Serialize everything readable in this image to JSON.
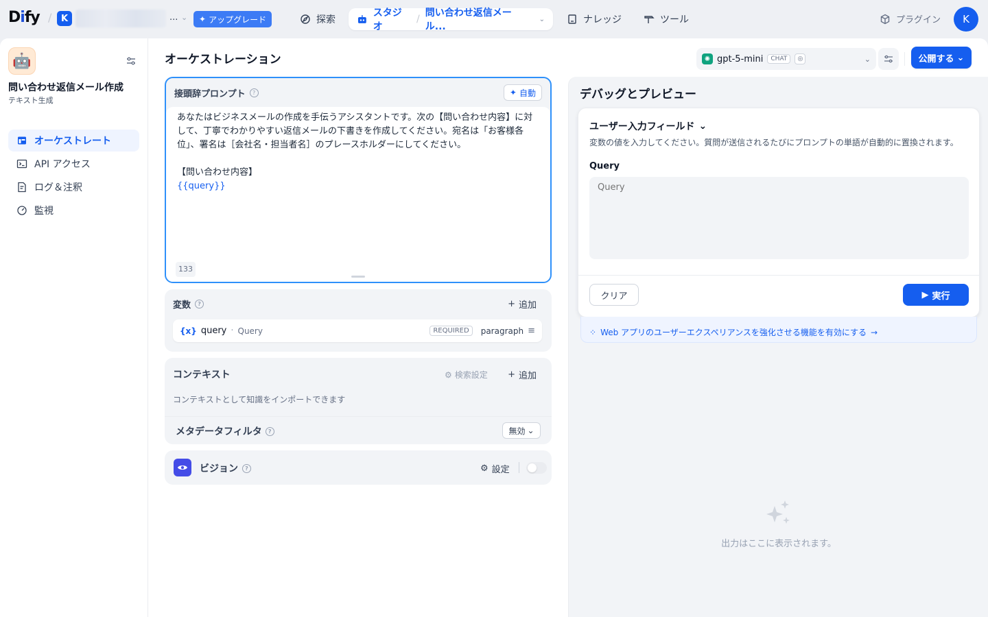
{
  "topbar": {
    "logo_prefix": "D",
    "logo_i": "i",
    "logo_suffix": "fy",
    "workspace_initial": "K",
    "workspace_ellipsis": "...",
    "upgrade_label": "アップグレード",
    "nav": {
      "explore": "探索",
      "studio": "スタジオ",
      "current_app": "問い合わせ返信メール...",
      "knowledge": "ナレッジ",
      "tools": "ツール"
    },
    "plugins_label": "プラグイン",
    "user_initial": "K"
  },
  "sidebar": {
    "app_icon": "🤖",
    "app_name": "問い合わせ返信メール作成",
    "app_type": "テキスト生成",
    "items": [
      {
        "label": "オーケストレート",
        "icon": "layout-icon",
        "active": true
      },
      {
        "label": "API アクセス",
        "icon": "terminal-icon",
        "active": false
      },
      {
        "label": "ログ＆注釈",
        "icon": "file-list-icon",
        "active": false
      },
      {
        "label": "監視",
        "icon": "dashboard-icon",
        "active": false
      }
    ]
  },
  "orchestration": {
    "title": "オーケストレーション",
    "model": {
      "name": "gpt-5-mini",
      "badge": "CHAT"
    },
    "publish_label": "公開する"
  },
  "prompt": {
    "title": "接頭辞プロンプト",
    "auto_label": "自動",
    "text": "あなたはビジネスメールの作成を手伝うアシスタントです。次の【問い合わせ内容】に対して、丁寧でわかりやすい返信メールの下書きを作成してください。宛名は「お客様各位」、署名は［会社名・担当者名］のプレースホルダーにしてください。\n\n【問い合わせ内容】",
    "variable_token": "{{query}}",
    "char_count": "133"
  },
  "variables": {
    "title": "変数",
    "add_label": "追加",
    "items": [
      {
        "icon": "{x}",
        "key": "query",
        "separator": "·",
        "label": "Query",
        "required": "REQUIRED",
        "type": "paragraph"
      }
    ]
  },
  "context": {
    "title": "コンテキスト",
    "retrieval_label": "検索設定",
    "add_label": "追加",
    "hint": "コンテキストとして知識をインポートできます",
    "metadata_label": "メタデータフィルタ",
    "metadata_value": "無効"
  },
  "vision": {
    "title": "ビジョン",
    "settings_label": "設定",
    "enabled": false
  },
  "debug": {
    "title": "デバッグとプレビュー",
    "user_input_title": "ユーザー入力フィールド",
    "user_input_desc": "変数の値を入力してください。質問が送信されるたびにプロンプトの単語が自動的に置換されます。",
    "query_label": "Query",
    "query_placeholder": "Query",
    "clear_label": "クリア",
    "run_label": "実行",
    "feature_banner": "Web アプリのユーザーエクスペリアンスを強化させる機能を有効にする",
    "output_placeholder": "出力はここに表示されます。"
  },
  "colors": {
    "primary": "#155eef",
    "focus_border": "#2e90fa",
    "vision_icon_bg": "#444ce7",
    "model_logo": "#10a37f"
  }
}
